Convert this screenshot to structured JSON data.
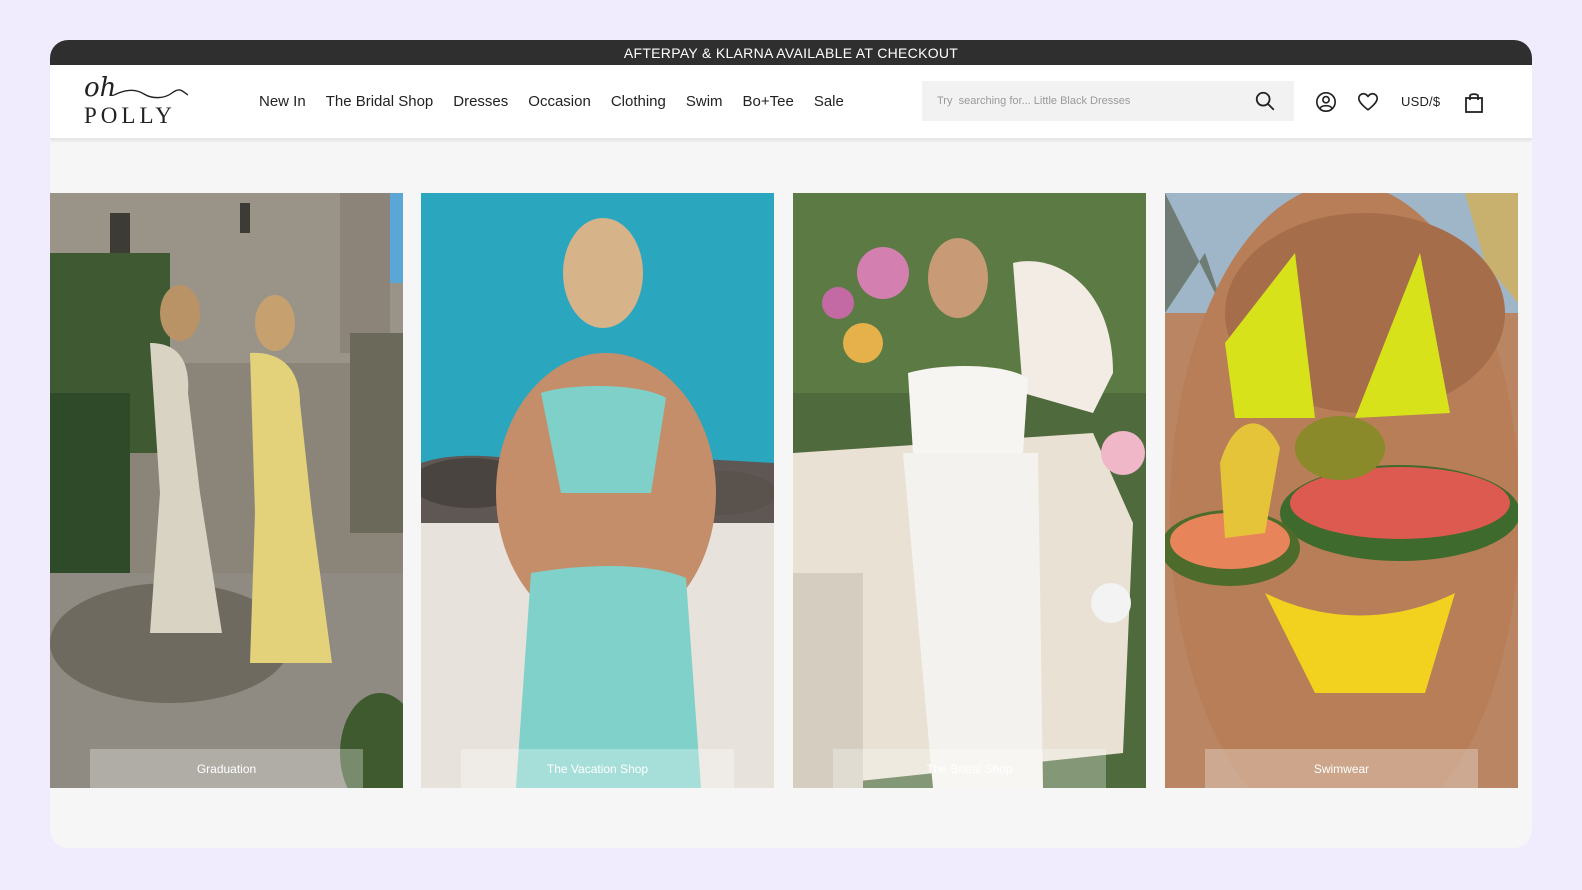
{
  "promo": {
    "text": "AFTERPAY & KLARNA AVAILABLE AT CHECKOUT"
  },
  "logo": {
    "script": "oh",
    "word": "POLLY"
  },
  "nav": [
    {
      "label": "New In"
    },
    {
      "label": "The Bridal Shop"
    },
    {
      "label": "Dresses"
    },
    {
      "label": "Occasion"
    },
    {
      "label": "Clothing"
    },
    {
      "label": "Swim"
    },
    {
      "label": "Bo+Tee"
    },
    {
      "label": "Sale"
    }
  ],
  "search": {
    "placeholder": "Try  searching for... Little Black Dresses",
    "icon": "search-icon"
  },
  "header_icons": {
    "account": "account-icon",
    "wishlist": "heart-icon",
    "currency": "USD/$",
    "bag": "bag-icon"
  },
  "colors": {
    "promo_bar": "#2f2f2f",
    "page_background": "#f1ecfd",
    "content_background": "#f6f6f6"
  },
  "tiles": [
    {
      "label": "Graduation"
    },
    {
      "label": "The Vacation Shop"
    },
    {
      "label": "The Bridal Shop"
    },
    {
      "label": "Swimwear"
    }
  ]
}
